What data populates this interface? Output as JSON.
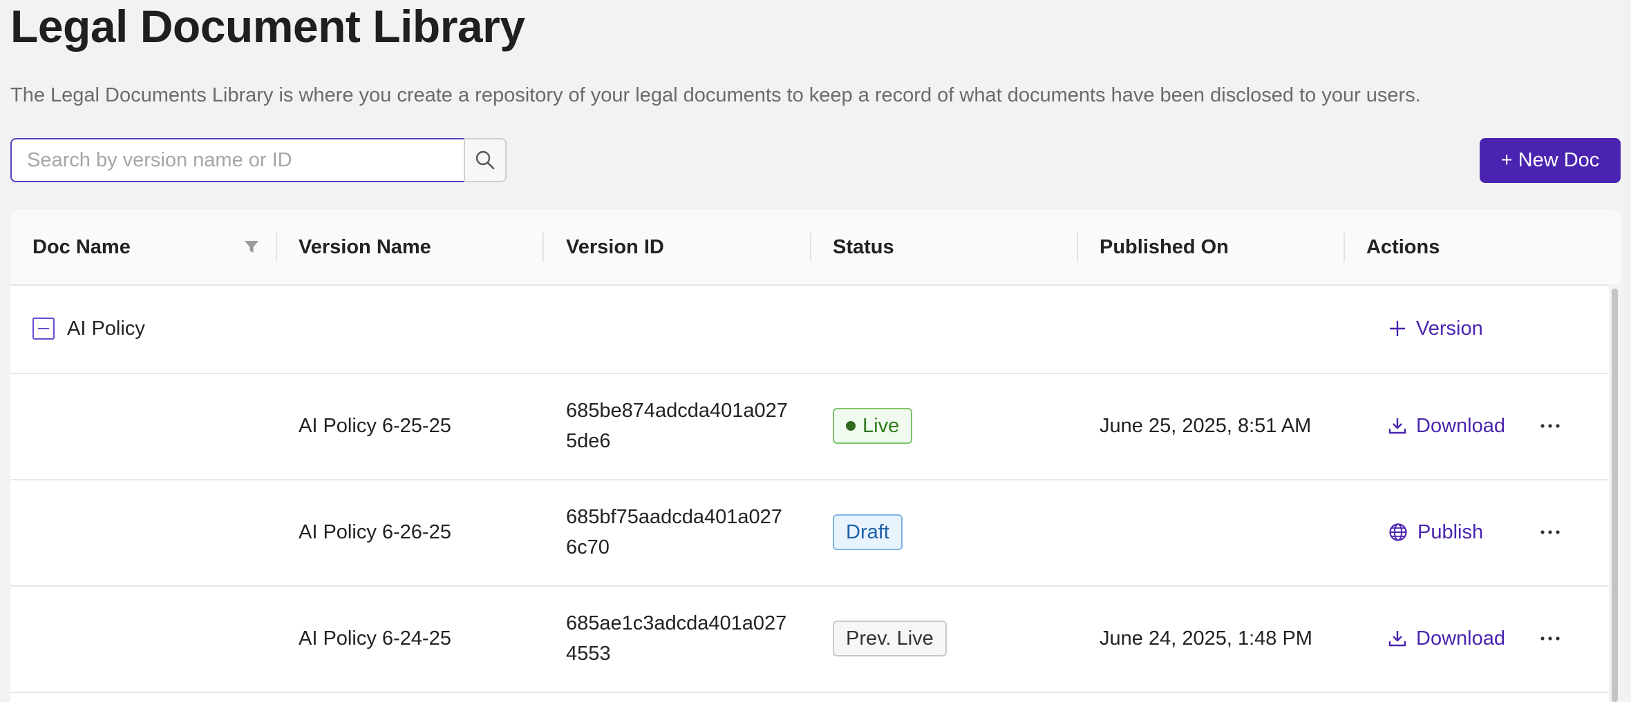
{
  "page": {
    "title": "Legal Document Library",
    "description": "The Legal Documents Library is where you create a repository of your legal documents to keep a record of what documents have been disclosed to your users."
  },
  "search": {
    "placeholder": "Search by version name or ID",
    "value": "",
    "button_icon": "search-icon"
  },
  "toolbar": {
    "new_doc_label": "+ New Doc",
    "accent_color": "#4a24b0"
  },
  "table": {
    "columns": [
      "Doc Name",
      "Version Name",
      "Version ID",
      "Status",
      "Published On",
      "Actions"
    ],
    "filter_icon": "filter-icon",
    "groups": [
      {
        "doc_name": "AI Policy",
        "expanded": true,
        "group_action": "Version",
        "group_action_icon": "plus-icon",
        "versions": [
          {
            "version_name": "AI Policy 6-25-25",
            "version_id_line1": "685be874adcda401a027",
            "version_id_line2": "5de6",
            "status": "Live",
            "status_color": "#2f7a1f",
            "published_on": "June 25, 2025, 8:51 AM",
            "action": "Download",
            "action_icon": "download-icon",
            "more_icon": "more-horizontal-icon"
          },
          {
            "version_name": "AI Policy 6-26-25",
            "version_id_line1": "685bf75aadcda401a027",
            "version_id_line2": "6c70",
            "status": "Draft",
            "status_color": "#1d5fa8",
            "published_on": "",
            "action": "Publish",
            "action_icon": "globe-icon",
            "more_icon": "more-horizontal-icon"
          },
          {
            "version_name": "AI Policy 6-24-25",
            "version_id_line1": "685ae1c3adcda401a027",
            "version_id_line2": "4553",
            "status": "Prev. Live",
            "status_color": "#333333",
            "published_on": "June 24, 2025, 1:48 PM",
            "action": "Download",
            "action_icon": "download-icon",
            "more_icon": "more-horizontal-icon"
          }
        ]
      }
    ]
  }
}
